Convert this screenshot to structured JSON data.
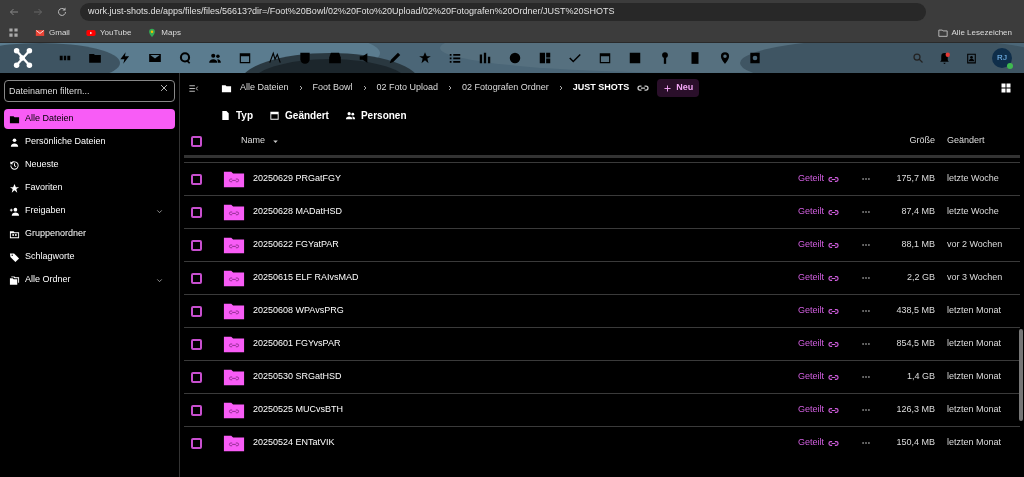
{
  "browser": {
    "url": "work.just-shots.de/apps/files/files/56613?dir=/Foot%20Bowl/02%20Foto%20Upload/02%20Fotografen%20Ordner/JUST%20SHOTS",
    "bookmarks": [
      "Gmail",
      "YouTube",
      "Maps"
    ],
    "all_bookmarks": "Alle Lesezeichen"
  },
  "app_header": {
    "avatar": "RJ"
  },
  "sidebar": {
    "filter": {
      "placeholder": "Dateinamen filtern..."
    },
    "items": [
      {
        "label": "Alle Dateien",
        "selected": true,
        "expandable": false
      },
      {
        "label": "Persönliche Dateien",
        "selected": false,
        "expandable": false
      },
      {
        "label": "Neueste",
        "selected": false,
        "expandable": false
      },
      {
        "label": "Favoriten",
        "selected": false,
        "expandable": false
      },
      {
        "label": "Freigaben",
        "selected": false,
        "expandable": true
      },
      {
        "label": "Gruppenordner",
        "selected": false,
        "expandable": false
      },
      {
        "label": "Schlagworte",
        "selected": false,
        "expandable": false
      },
      {
        "label": "Alle Ordner",
        "selected": false,
        "expandable": true
      }
    ]
  },
  "breadcrumbs": [
    "Alle Dateien",
    "Foot Bowl",
    "02 Foto Upload",
    "02 Fotografen Ordner",
    "JUST SHOTS"
  ],
  "new_button": "Neu",
  "filters": [
    "Typ",
    "Geändert",
    "Personen"
  ],
  "table": {
    "select_all_checked": false,
    "columns": [
      "Name",
      "Größe",
      "Geändert"
    ],
    "rows": [
      {
        "name": "20250629 PRGatFGY",
        "share": "Geteilt",
        "size": "175,7 MB",
        "modified": "letzte Woche",
        "checked": false
      },
      {
        "name": "20250628 MADatHSD",
        "share": "Geteilt",
        "size": "87,4 MB",
        "modified": "letzte Woche",
        "checked": false
      },
      {
        "name": "20250622 FGYatPAR",
        "share": "Geteilt",
        "size": "88,1 MB",
        "modified": "vor 2 Wochen",
        "checked": false
      },
      {
        "name": "20250615 ELF RAIvsMAD",
        "share": "Geteilt",
        "size": "2,2 GB",
        "modified": "vor 3 Wochen",
        "checked": false
      },
      {
        "name": "20250608 WPAvsPRG",
        "share": "Geteilt",
        "size": "438,5 MB",
        "modified": "letzten Monat",
        "checked": false
      },
      {
        "name": "20250601 FGYvsPAR",
        "share": "Geteilt",
        "size": "854,5 MB",
        "modified": "letzten Monat",
        "checked": false
      },
      {
        "name": "20250530 SRGatHSD",
        "share": "Geteilt",
        "size": "1,4 GB",
        "modified": "letzten Monat",
        "checked": false
      },
      {
        "name": "20250525 MUCvsBTH",
        "share": "Geteilt",
        "size": "126,3 MB",
        "modified": "letzten Monat",
        "checked": false
      },
      {
        "name": "20250524 ENTatVIK",
        "share": "Geteilt",
        "size": "150,4 MB",
        "modified": "letzten Monat",
        "checked": false
      }
    ]
  }
}
